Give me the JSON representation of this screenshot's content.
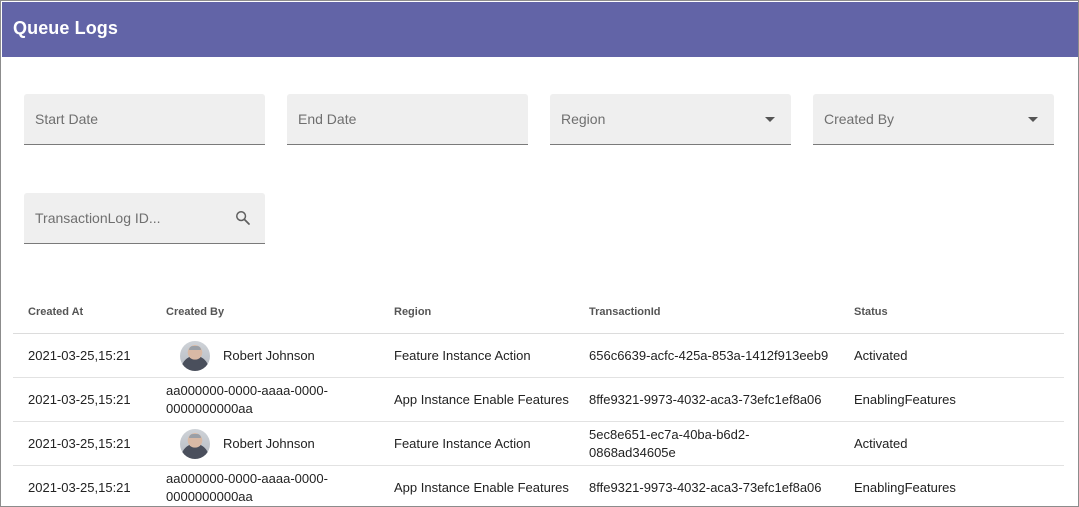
{
  "header": {
    "title": "Queue Logs"
  },
  "filters": {
    "start_date": {
      "placeholder": "Start Date"
    },
    "end_date": {
      "placeholder": "End Date"
    },
    "region": {
      "label": "Region"
    },
    "created_by": {
      "label": "Created By"
    },
    "transaction_log_id": {
      "placeholder": "TransactionLog ID..."
    }
  },
  "table": {
    "columns": [
      "Created At",
      "Created By",
      "Region",
      "TransactionId",
      "Status"
    ],
    "rows": [
      {
        "created_at": "2021-03-25,15:21",
        "created_by": "Robert Johnson",
        "has_avatar": true,
        "region": "Feature Instance Action",
        "transaction_id": "656c6639-acfc-425a-853a-1412f913eeb9",
        "status": "Activated"
      },
      {
        "created_at": "2021-03-25,15:21",
        "created_by": "aa000000-0000-aaaa-0000-0000000000aa",
        "has_avatar": false,
        "region": "App Instance Enable Features",
        "transaction_id": "8ffe9321-9973-4032-aca3-73efc1ef8a06",
        "status": "EnablingFeatures"
      },
      {
        "created_at": "2021-03-25,15:21",
        "created_by": "Robert Johnson",
        "has_avatar": true,
        "region": "Feature Instance Action",
        "transaction_id": "5ec8e651-ec7a-40ba-b6d2-0868ad34605e",
        "status": "Activated"
      },
      {
        "created_at": "2021-03-25,15:21",
        "created_by": "aa000000-0000-aaaa-0000-0000000000aa",
        "has_avatar": false,
        "region": "App Instance Enable Features",
        "transaction_id": "8ffe9321-9973-4032-aca3-73efc1ef8a06",
        "status": "EnablingFeatures"
      }
    ]
  },
  "colors": {
    "header_bg": "#6264a7",
    "field_bg": "#efefef"
  },
  "icons": {
    "dropdown": "caret-down-icon",
    "search": "search-icon",
    "avatar": "user-avatar"
  }
}
